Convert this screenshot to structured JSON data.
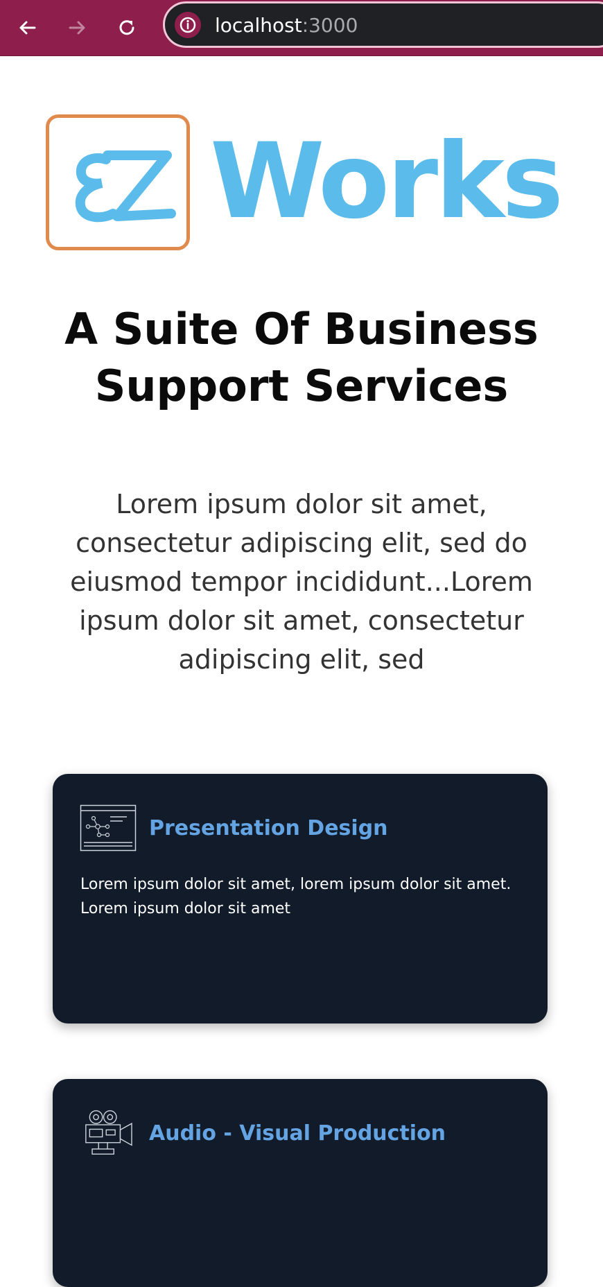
{
  "browser": {
    "url_host": "localhost",
    "url_port": ":3000",
    "colors": {
      "bar": "#8e1f4d",
      "url_bg": "#202124"
    }
  },
  "logo": {
    "mark_text": "EZ",
    "word_text": "Works",
    "colors": {
      "frame": "#e08a4e",
      "text": "#5bbcec"
    }
  },
  "hero": {
    "title_line1": "A Suite Of Business",
    "title_line2": "Support Services",
    "description": "Lorem ipsum dolor sit amet, consectetur adipiscing elit, sed do eiusmod tempor incididunt...Lorem ipsum dolor sit amet, consectetur adipiscing elit, sed"
  },
  "services": [
    {
      "title": "Presentation Design",
      "description": "Lorem ipsum dolor sit amet, lorem ipsum dolor sit amet. Lorem ipsum dolor sit amet",
      "icon": "presentation-board-icon"
    },
    {
      "title": "Audio - Visual Production",
      "icon": "video-camera-icon"
    }
  ],
  "colors": {
    "card_bg": "#111b29",
    "card_title": "#64a4e3",
    "card_text": "#ffffff"
  }
}
